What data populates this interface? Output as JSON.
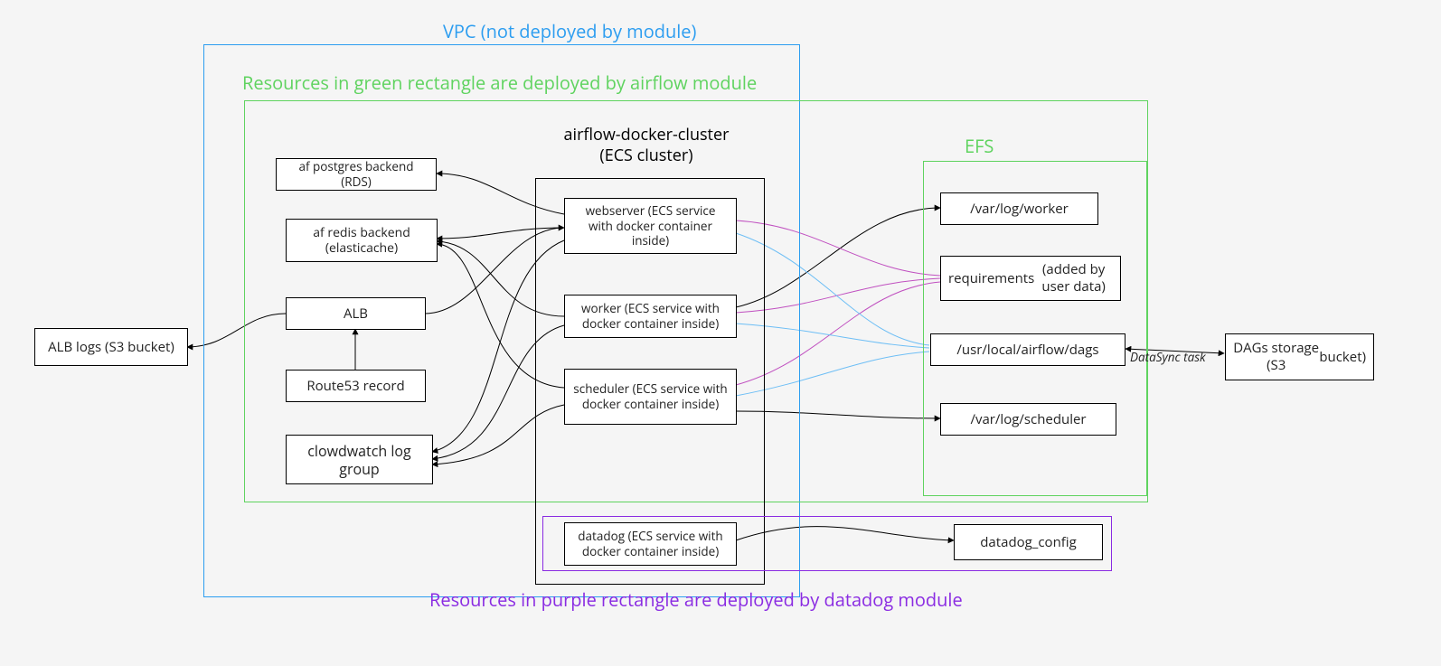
{
  "titles": {
    "vpc": "VPC (not deployed by module)",
    "green": "Resources in green rectangle are deployed by airflow module",
    "purple": "Resources in purple rectangle are deployed by datadog module",
    "ecs_line1": "airflow-docker-cluster",
    "ecs_line2": "(ECS cluster)",
    "efs": "EFS"
  },
  "nodes": {
    "alb_logs": "ALB logs (S3 bucket)",
    "rds": "af postgres backend (RDS)",
    "redis": "af redis backend (elasticache)",
    "alb": "ALB",
    "route53": "Route53 record",
    "cwlog": "clowdwatch log group",
    "webserver": "webserver (ECS service with docker container inside)",
    "worker": "worker (ECS service with docker container inside)",
    "scheduler": "scheduler (ECS service with docker container inside)",
    "datadog": "datadog (ECS service with docker container inside)",
    "efs_worker": "/var/log/worker",
    "efs_req_line1": "requirements",
    "efs_req_line2": "(added by user data)",
    "efs_dags": "/usr/local/airflow/dags",
    "efs_sched": "/var/log/scheduler",
    "datadog_cfg": "datadog_config",
    "dags_s3_line1": "DAGs storage (S3",
    "dags_s3_line2": "bucket)"
  },
  "edges": {
    "datasync": "DataSync task"
  },
  "colors": {
    "black": "#000000",
    "blue": "#2c9df0",
    "green": "#5fd35f",
    "purple": "#8a2be2",
    "magenta": "#c050c0",
    "skyblue": "#6dbef5"
  }
}
